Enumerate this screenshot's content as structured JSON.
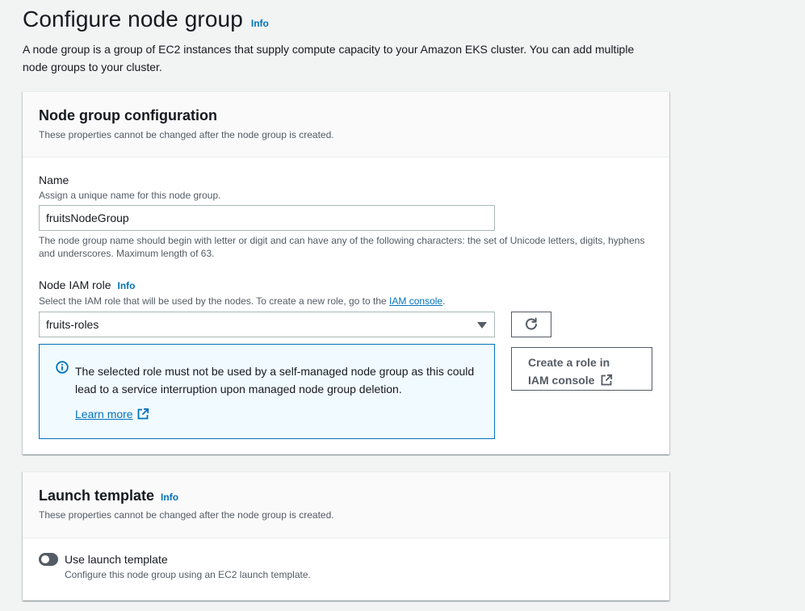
{
  "header": {
    "title": "Configure node group",
    "info": "Info",
    "description": "A node group is a group of EC2 instances that supply compute capacity to your Amazon EKS cluster. You can add multiple node groups to your cluster."
  },
  "config_panel": {
    "title": "Node group configuration",
    "subtitle": "These properties cannot be changed after the node group is created.",
    "name_field": {
      "label": "Name",
      "description": "Assign a unique name for this node group.",
      "value": "fruitsNodeGroup",
      "constraint": "The node group name should begin with letter or digit and can have any of the following characters: the set of Unicode letters, digits, hyphens and underscores. Maximum length of 63."
    },
    "role_field": {
      "label": "Node IAM role",
      "info": "Info",
      "description_prefix": "Select the IAM role that will be used by the nodes. To create a new role, go to the ",
      "description_link": "IAM console",
      "description_suffix": ".",
      "selected": "fruits-roles"
    },
    "alert": {
      "text": "The selected role must not be used by a self-managed node group as this could lead to a service interruption upon managed node group deletion.",
      "learn_more": "Learn more"
    },
    "create_role_button": {
      "line1": "Create a role in",
      "line2": "IAM console"
    }
  },
  "launch_panel": {
    "title": "Launch template",
    "info": "Info",
    "subtitle": "These properties cannot be changed after the node group is created.",
    "toggle": {
      "label": "Use launch template",
      "description": "Configure this node group using an EC2 launch template.",
      "checked": false
    }
  },
  "colors": {
    "link": "#0073bb",
    "background": "#f2f3f3",
    "alert_bg": "#f1faff",
    "toggle_off": "#545b64"
  },
  "icons": {
    "refresh": "refresh-icon",
    "info_circle": "info-circle-icon",
    "external": "external-link-icon",
    "caret": "caret-down-icon"
  }
}
